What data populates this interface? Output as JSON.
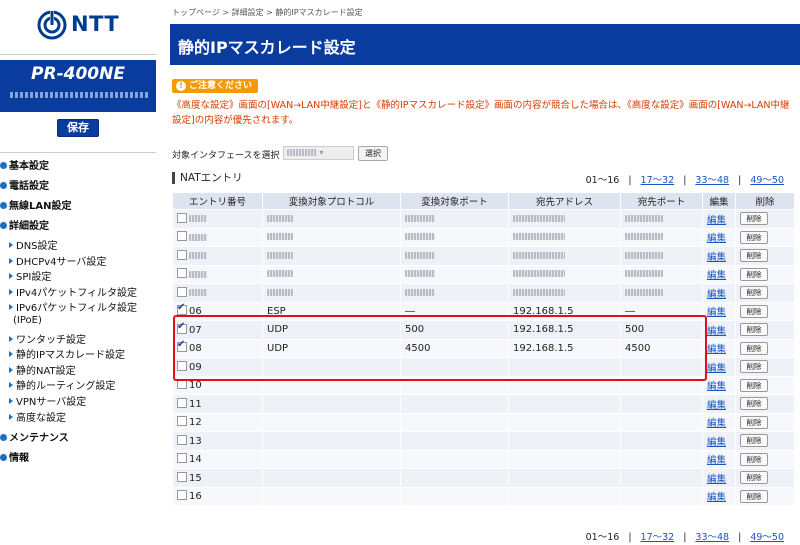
{
  "brand": {
    "logo_text": "NTT",
    "model": "PR-400NE"
  },
  "save_label": "保存",
  "nav": {
    "top": [
      {
        "label": "基本設定"
      },
      {
        "label": "電話設定"
      },
      {
        "label": "無線LAN設定"
      },
      {
        "label": "詳細設定"
      }
    ],
    "sub": [
      {
        "label": "DNS設定"
      },
      {
        "label": "DHCPv4サーバ設定"
      },
      {
        "label": "SPI設定"
      },
      {
        "label": "IPv4パケットフィルタ設定"
      },
      {
        "label": "IPv6パケットフィルタ設定"
      },
      {
        "label": "(IPoE)"
      },
      {
        "label": "ワンタッチ設定"
      },
      {
        "label": "静的IPマスカレード設定"
      },
      {
        "label": "静的NAT設定"
      },
      {
        "label": "静的ルーティング設定"
      },
      {
        "label": "VPNサーバ設定"
      },
      {
        "label": "高度な設定"
      }
    ],
    "bottom": [
      {
        "label": "メンテナンス"
      },
      {
        "label": "情報"
      }
    ]
  },
  "breadcrumb": "トップページ > 詳細設定 > 静的IPマスカレード設定",
  "page_title": "静的IPマスカレード設定",
  "caution_label": "ご注意ください",
  "warning_text": "《高度な設定》画面の[WAN→LAN中継設定]と《静的IPマスカレード設定》画面の内容が競合した場合は、《高度な設定》画面の[WAN→LAN中継設定]の内容が優先されます。",
  "interface_label": "対象インタフェースを選択",
  "select_button": "選択",
  "pager": {
    "current": "01〜16",
    "links": [
      "17〜32",
      "33〜48",
      "49〜50"
    ]
  },
  "section_title": "NATエントリ",
  "table": {
    "headers": [
      "エントリ番号",
      "変換対象プロトコル",
      "変換対象ポート",
      "宛先アドレス",
      "宛先ポート",
      "編集",
      "削除"
    ],
    "edit_label": "編集",
    "delete_label": "削除",
    "rows": [
      {
        "no": "",
        "checked": false,
        "protocol": "",
        "port": "",
        "address": "",
        "dport": "",
        "blurred": true
      },
      {
        "no": "",
        "checked": false,
        "protocol": "",
        "port": "",
        "address": "",
        "dport": "",
        "blurred": true
      },
      {
        "no": "",
        "checked": false,
        "protocol": "",
        "port": "",
        "address": "",
        "dport": "",
        "blurred": true
      },
      {
        "no": "",
        "checked": false,
        "protocol": "",
        "port": "",
        "address": "",
        "dport": "",
        "blurred": true
      },
      {
        "no": "",
        "checked": false,
        "protocol": "",
        "port": "",
        "address": "",
        "dport": "",
        "blurred": true
      },
      {
        "no": "06",
        "checked": true,
        "protocol": "ESP",
        "port": "―",
        "address": "192.168.1.5",
        "dport": "―",
        "blurred": false
      },
      {
        "no": "07",
        "checked": true,
        "protocol": "UDP",
        "port": "500",
        "address": "192.168.1.5",
        "dport": "500",
        "blurred": false
      },
      {
        "no": "08",
        "checked": true,
        "protocol": "UDP",
        "port": "4500",
        "address": "192.168.1.5",
        "dport": "4500",
        "blurred": false
      },
      {
        "no": "09",
        "checked": false,
        "protocol": "",
        "port": "",
        "address": "",
        "dport": "",
        "blurred": false
      },
      {
        "no": "10",
        "checked": false,
        "protocol": "",
        "port": "",
        "address": "",
        "dport": "",
        "blurred": false
      },
      {
        "no": "11",
        "checked": false,
        "protocol": "",
        "port": "",
        "address": "",
        "dport": "",
        "blurred": false
      },
      {
        "no": "12",
        "checked": false,
        "protocol": "",
        "port": "",
        "address": "",
        "dport": "",
        "blurred": false
      },
      {
        "no": "13",
        "checked": false,
        "protocol": "",
        "port": "",
        "address": "",
        "dport": "",
        "blurred": false
      },
      {
        "no": "14",
        "checked": false,
        "protocol": "",
        "port": "",
        "address": "",
        "dport": "",
        "blurred": false
      },
      {
        "no": "15",
        "checked": false,
        "protocol": "",
        "port": "",
        "address": "",
        "dport": "",
        "blurred": false
      },
      {
        "no": "16",
        "checked": false,
        "protocol": "",
        "port": "",
        "address": "",
        "dport": "",
        "blurred": false
      }
    ]
  },
  "colors": {
    "brand_blue": "#0a3ca0",
    "warning": "#d63b00",
    "caution_bg": "#f59a00",
    "highlight": "#e0101a",
    "link": "#1a55c4"
  }
}
